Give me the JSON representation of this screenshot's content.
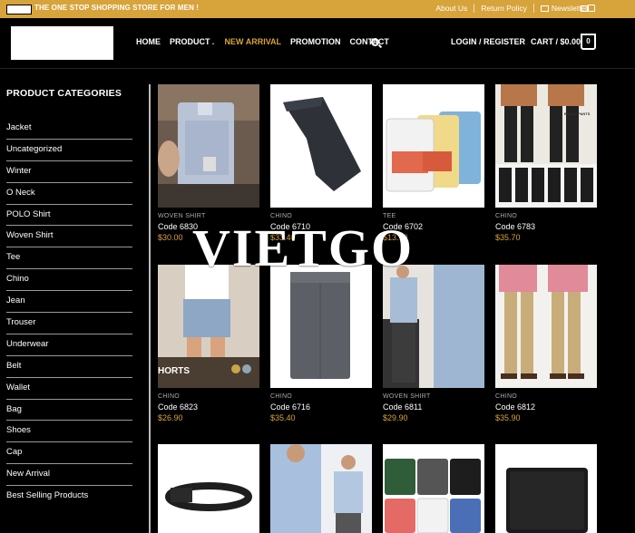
{
  "topbar": {
    "tagline": "THE ONE STOP SHOPPING STORE FOR MEN !",
    "links": [
      "About Us",
      "Return Policy"
    ],
    "newsletter": "Newsletter"
  },
  "header": {
    "nav": {
      "home": "HOME",
      "product": "PRODUCT",
      "new_arrival": "NEW ARRIVAL",
      "promotion": "PROMOTION",
      "contact": "CONTACT"
    },
    "login": "LOGIN / REGISTER",
    "cart": "CART / $0.00",
    "cart_count": "0"
  },
  "sidebar": {
    "title": "PRODUCT CATEGORIES",
    "items": [
      "Jacket",
      "Uncategorized",
      "Winter",
      "O Neck",
      "POLO Shirt",
      "Woven Shirt",
      "Tee",
      "Chino",
      "Jean",
      "Trouser",
      "Underwear",
      "Belt",
      "Wallet",
      "Bag",
      "Shoes",
      "Cap",
      "New Arrival",
      "Best Selling Products"
    ]
  },
  "products": [
    {
      "category": "WOVEN SHIRT",
      "name": "Code 6830",
      "price": "$30.00"
    },
    {
      "category": "CHINO",
      "name": "Code 6710",
      "price": "$33.40"
    },
    {
      "category": "TEE",
      "name": "Code 6702",
      "price": "$13.70"
    },
    {
      "category": "CHINO",
      "name": "Code 6783",
      "price": "$35.70"
    },
    {
      "category": "CHINO",
      "name": "Code 6823",
      "price": "$26.90"
    },
    {
      "category": "CHINO",
      "name": "Code 6716",
      "price": "$35.40"
    },
    {
      "category": "WOVEN SHIRT",
      "name": "Code 6811",
      "price": "$29.90"
    },
    {
      "category": "CHINO",
      "name": "Code 6812",
      "price": "$35.90"
    }
  ],
  "image_text": {
    "shorts_banner": "HORTS",
    "pants_tag": "BLACK PANTS"
  },
  "watermark": "VIETGO",
  "colors": {
    "accent": "#d7a33b",
    "background": "#000000"
  }
}
